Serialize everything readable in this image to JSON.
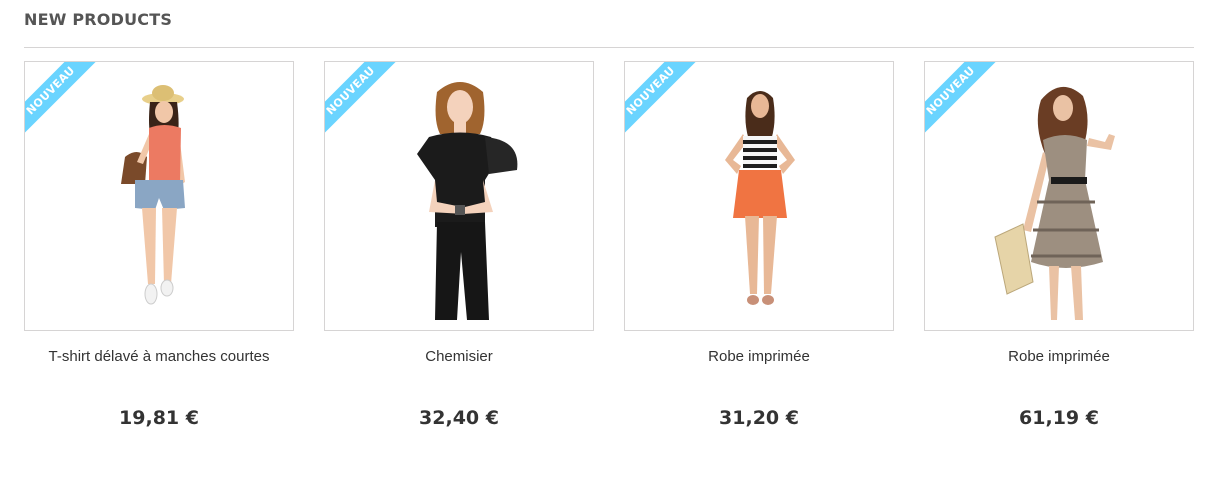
{
  "section": {
    "title": "NEW PRODUCTS"
  },
  "colors": {
    "badge": "#6ad4ff",
    "border": "#d6d4d4",
    "text": "#333333"
  },
  "products": [
    {
      "badge": "NOUVEAU",
      "name": "T-shirt délavé à manches courtes",
      "price": "19,81 €",
      "image": "woman-straw-hat-orange-top-denim-shorts"
    },
    {
      "badge": "NOUVEAU",
      "name": "Chemisier",
      "price": "32,40 €",
      "image": "woman-black-ruffled-blouse"
    },
    {
      "badge": "NOUVEAU",
      "name": "Robe imprimée",
      "price": "31,20 €",
      "image": "woman-striped-top-orange-skirt"
    },
    {
      "badge": "NOUVEAU",
      "name": "Robe imprimée",
      "price": "61,19 €",
      "image": "woman-printed-belted-dress"
    }
  ]
}
